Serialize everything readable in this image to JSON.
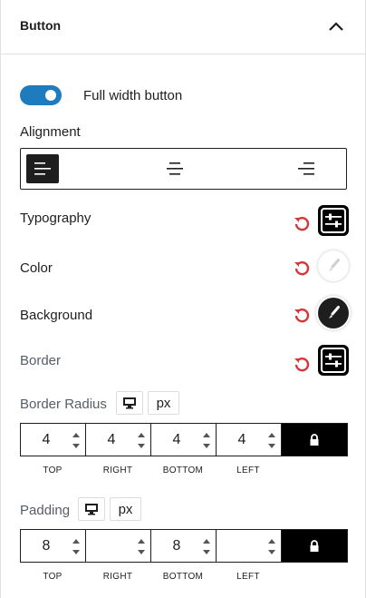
{
  "panel": {
    "title": "Button",
    "toggle_label": "Full width button",
    "toggle_on": true
  },
  "alignment": {
    "label": "Alignment",
    "options": [
      "left",
      "center",
      "right"
    ],
    "selected": "left"
  },
  "typography": {
    "label": "Typography"
  },
  "color": {
    "label": "Color"
  },
  "background": {
    "label": "Background"
  },
  "border": {
    "label": "Border"
  },
  "border_radius": {
    "label": "Border Radius",
    "unit": "px",
    "values": [
      "4",
      "4",
      "4",
      "4"
    ],
    "sides": [
      "TOP",
      "RIGHT",
      "BOTTOM",
      "LEFT"
    ]
  },
  "padding": {
    "label": "Padding",
    "unit": "px",
    "values": [
      "8",
      "",
      "8",
      ""
    ],
    "sides": [
      "TOP",
      "RIGHT",
      "BOTTOM",
      "LEFT"
    ]
  },
  "colors": {
    "toggle": "#1e7bbd",
    "reset": "#d63638",
    "dark": "#1e1e1e"
  }
}
